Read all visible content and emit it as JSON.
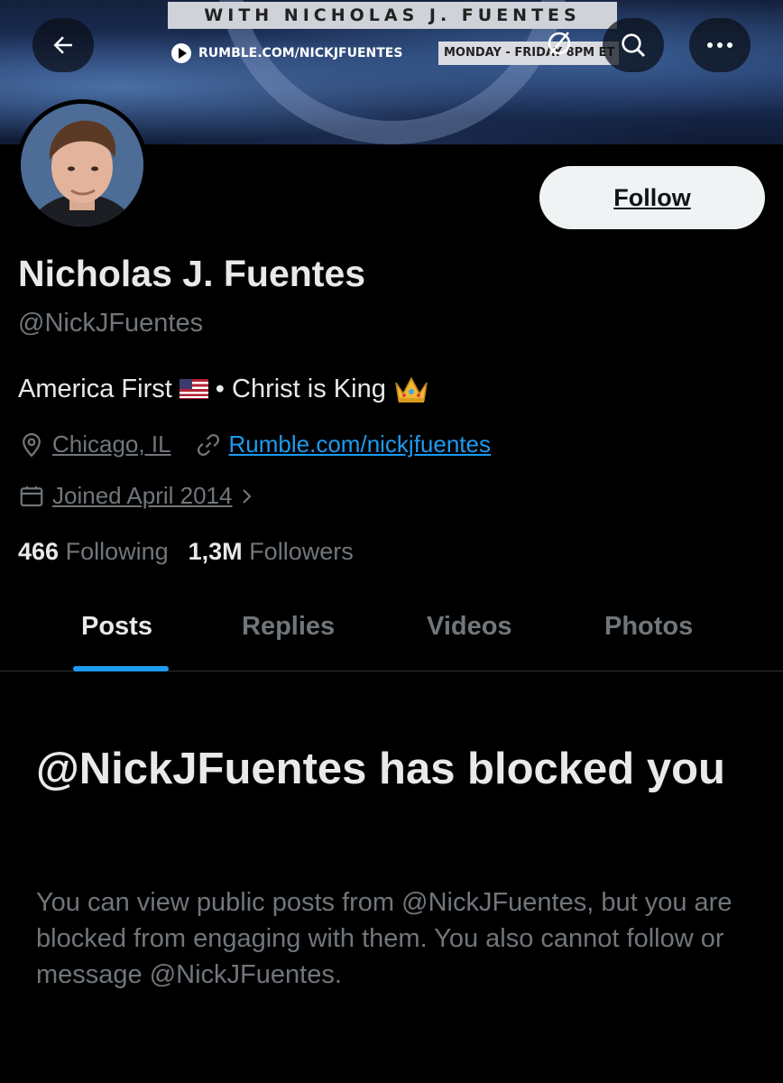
{
  "banner": {
    "title": "WITH NICHOLAS J. FUENTES",
    "rumble": "RUMBLE.COM/NICKJFUENTES",
    "schedule": "MONDAY - FRIDAY 8PM ET"
  },
  "icons": {
    "back": "arrow-left-icon",
    "search": "search-icon",
    "more": "more-icon",
    "location": "location-pin-icon",
    "link": "link-icon",
    "calendar": "calendar-icon"
  },
  "profile": {
    "name": "Nicholas J. Fuentes",
    "handle": "@NickJFuentes",
    "bio_part1": "America First",
    "bio_part2": "• Christ is King",
    "location": "Chicago, IL",
    "website": "Rumble.com/nickjfuentes",
    "joined": "Joined April 2014",
    "following_count": "466",
    "following_label": "Following",
    "followers_count": "1,3M",
    "followers_label": "Followers"
  },
  "actions": {
    "follow_label": "Follow"
  },
  "tabs": [
    {
      "label": "Posts",
      "active": true
    },
    {
      "label": "Replies",
      "active": false
    },
    {
      "label": "Videos",
      "active": false
    },
    {
      "label": "Photos",
      "active": false
    }
  ],
  "blocked": {
    "title": "@NickJFuentes has blocked you",
    "body": "You can view public posts from @NickJFuentes, but you are blocked from engaging with them. You also cannot follow or message @NickJFuentes."
  },
  "colors": {
    "accent": "#1d9bf0",
    "background": "#000000",
    "text_primary": "#e7e9ea",
    "text_secondary": "#71767b"
  }
}
